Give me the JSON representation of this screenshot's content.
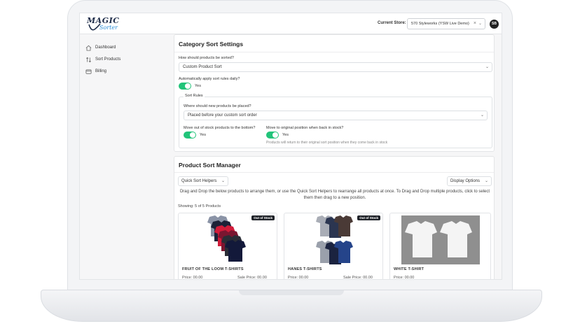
{
  "app": {
    "logo": {
      "top": "MAGIC",
      "bottom": "Sorter"
    },
    "store_label": "Current Store:",
    "store_value": "570 Styleworks (YSW Live Demo)",
    "avatar_initials": "SB"
  },
  "sidebar": {
    "items": [
      {
        "label": "Dashboard",
        "icon": "home-icon"
      },
      {
        "label": "Sort Products",
        "icon": "sort-arrows-icon"
      },
      {
        "label": "Billing",
        "icon": "card-icon"
      }
    ]
  },
  "category_settings": {
    "title": "Category Sort Settings",
    "sort_question": "How should products be sorted?",
    "sort_value": "Custom Product Sort",
    "auto_apply_question": "Automatically apply sort rules daily?",
    "auto_apply_value": "Yes",
    "sort_rules_legend": "Sort Rules",
    "new_products_question": "Where should new products be placed?",
    "new_products_value": "Placed before your custom sort order",
    "out_of_stock_question": "Move out of stock products to the bottom?",
    "out_of_stock_value": "Yes",
    "restock_question": "Move to original position when back in stock?",
    "restock_value": "Yes",
    "restock_hint": "Products will return to their original sort position when they come back in stock"
  },
  "sort_manager": {
    "title": "Product Sort Manager",
    "quick_sort_label": "Quick Sort Helpers",
    "display_options_label": "Display Options",
    "instructions": "Drag and Drop the below products to arrange them, or use the Quick Sort Helpers to rearrange all products at once. To Drag and Drop multiple products, click to select them then drag to a new position.",
    "showing": "Showing: 5 of 5 Products",
    "products": [
      {
        "name": "FRUIT OF THE LOOM T-SHIRTS",
        "badge": "Out of Stock",
        "price": "Price: 00.00",
        "sale_price": "Sale Price: 00.00"
      },
      {
        "name": "HANES T-SHIRTS",
        "badge": "Out of Stock",
        "price": "Price: 00.00",
        "sale_price": "Sale Price: 00.00"
      },
      {
        "name": "WHITE T-SHIRT",
        "badge": "",
        "price": "Price: 00.00",
        "sale_price": ""
      }
    ]
  },
  "colors": {
    "toggle_on": "#22c47a",
    "badge_bg": "#1f2228",
    "brand_navy": "#1d2b48",
    "brand_blue": "#2e8fd6"
  }
}
